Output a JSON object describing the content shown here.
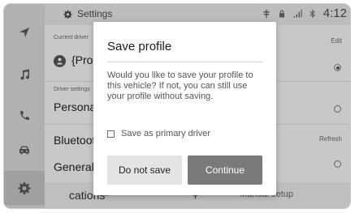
{
  "topbar": {
    "title": "Settings",
    "time": "4:12"
  },
  "status_icons": [
    "signal-icon",
    "lock-icon",
    "cellular-icon",
    "bluetooth-icon"
  ],
  "rail": {
    "items": [
      "navigation-icon",
      "music-icon",
      "phone-icon",
      "car-icon",
      "settings-icon"
    ]
  },
  "list": {
    "current_driver_label": "Current driver",
    "edit_label": "Edit",
    "profile_name": "{Pro",
    "driver_settings_label": "Driver settings",
    "personal_label": "Personal",
    "bluetooth_label": "Bluetoot",
    "refresh_label": "Refresh",
    "general_label": "General",
    "applications_label": "cations",
    "manual_setup_label": "Manual setup"
  },
  "modal": {
    "title": "Save profile",
    "message": "Would you like to save your profile to this vehicle? If not, you can still use your profile without saving.",
    "checkbox_label": "Save as primary driver",
    "checkbox_checked": false,
    "secondary_button": "Do not save",
    "primary_button": "Continue"
  },
  "colors": {
    "primary_button": "#7a7a7a",
    "secondary_button": "#e4e4e4",
    "rail": "#d8d8d8"
  }
}
